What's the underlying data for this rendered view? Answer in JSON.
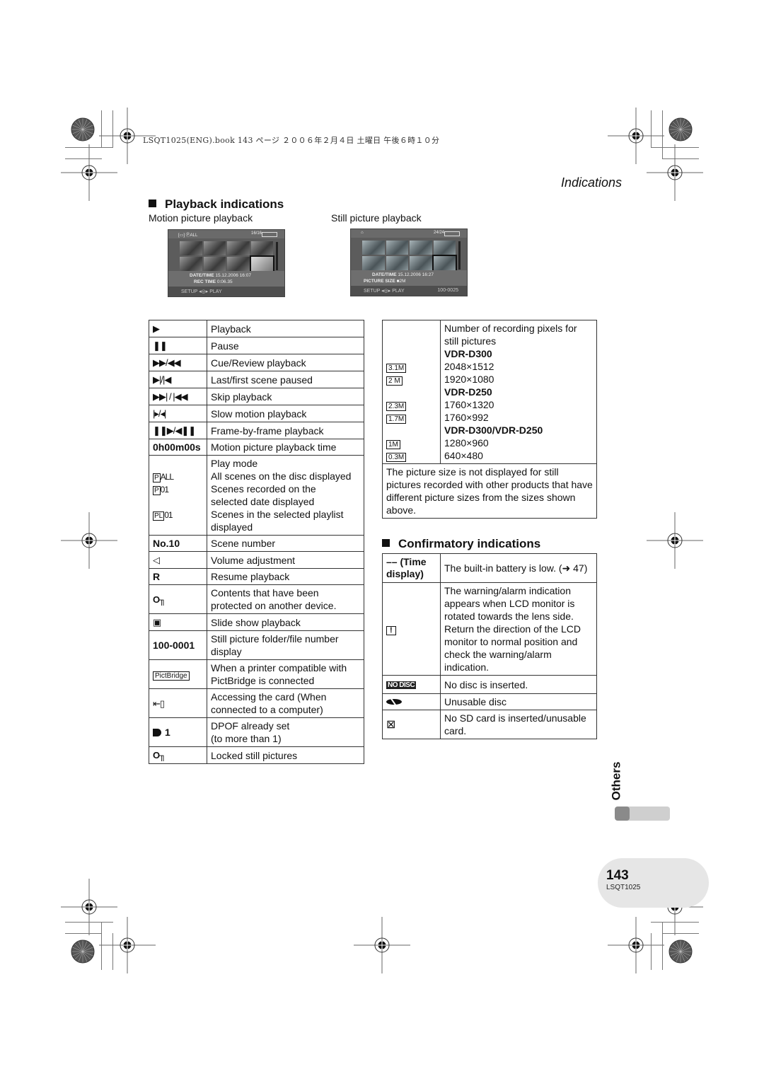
{
  "print_header": "LSQT1025(ENG).book  143 ページ  ２００６年２月４日  土曜日  午後６時１０分",
  "running_head": "Indications",
  "playback_section": {
    "title": "Playback indications",
    "motion_caption": "Motion picture playback",
    "still_caption": "Still picture playback",
    "motion_screen": {
      "top_left": "[▭] ⓅALL",
      "top_right": "16/16",
      "line1_label": "DATE/TIME",
      "line1_value": "15.12.2006  16:07",
      "line2_label": "REC TIME",
      "line2_value": "0:06.35",
      "bottom_left": "SETUP ◂◎▸ PLAY",
      "bottom_right": ""
    },
    "still_screen": {
      "top_left": "⌂",
      "top_right": "24/24",
      "line1_label": "DATE/TIME",
      "line1_value": "15.12.2006  16:27",
      "line2_label": "PICTURE SIZE",
      "line2_value": "■2M",
      "bottom_left": "SETUP ◂◎▸ PLAY",
      "bottom_right": "100-0025"
    }
  },
  "left_table": [
    {
      "symbol": "▶",
      "icon": "play-icon",
      "desc": "Playback"
    },
    {
      "symbol": "❚❚",
      "icon": "pause-icon",
      "desc": "Pause"
    },
    {
      "symbol": "▶▶/◀◀",
      "icon": "cue-review-icon",
      "desc": "Cue/Review playback"
    },
    {
      "symbol": "▶|/|◀",
      "icon": "last-first-scene-icon",
      "desc": "Last/first scene paused"
    },
    {
      "symbol": "▶▶| / |◀◀",
      "icon": "skip-icon",
      "desc": "Skip playback"
    },
    {
      "symbol": "|▸/◂|",
      "icon": "slow-motion-icon",
      "desc": "Slow motion playback"
    },
    {
      "symbol": "❚❚▶/◀❚❚",
      "icon": "frame-by-frame-icon",
      "desc": "Frame-by-frame playback"
    },
    {
      "symbol": "0h00m00s",
      "icon": "",
      "desc": "Motion picture playback time"
    },
    {
      "symbol": "",
      "icon": "play-mode-icon",
      "desc_lines": [
        "Play mode",
        "All scenes on the disc displayed",
        "Scenes recorded on the",
        "selected date displayed",
        "Scenes in the selected playlist",
        "displayed"
      ],
      "sub_symbols": [
        "P ALL",
        "P 01",
        "PL 01"
      ]
    },
    {
      "symbol": "No.10",
      "icon": "",
      "desc": "Scene number"
    },
    {
      "symbol": "◁",
      "icon": "volume-icon",
      "desc": "Volume adjustment"
    },
    {
      "symbol": "R",
      "icon": "",
      "desc": "Resume playback"
    },
    {
      "symbol": "O╖",
      "icon": "key-protect-icon",
      "desc": "Contents that have been protected on another device."
    },
    {
      "symbol": "▣",
      "icon": "slideshow-icon",
      "desc": "Slide show playback"
    },
    {
      "symbol": "100-0001",
      "icon": "",
      "desc": "Still picture folder/file number display"
    },
    {
      "symbol": "PictBridge",
      "icon": "pictbridge-icon",
      "desc": "When a printer compatible with PictBridge is connected"
    },
    {
      "symbol": "⇤▯",
      "icon": "card-access-icon",
      "desc": "Accessing the card (When connected to a computer)"
    },
    {
      "symbol": "1",
      "icon": "dpof-icon",
      "desc_lines": [
        "DPOF already set",
        "(to more than 1)"
      ]
    },
    {
      "symbol": "O╖",
      "icon": "lock-icon",
      "desc": "Locked still pictures"
    }
  ],
  "right_table": {
    "header": [
      "Number of recording pixels for",
      "still pictures"
    ],
    "groups": [
      {
        "model": "VDR-D300",
        "sizes": [
          {
            "badge": "3.1M",
            "pixels": "2048×1512"
          },
          {
            "badge": "2 M",
            "pixels": "1920×1080"
          }
        ]
      },
      {
        "model": "VDR-D250",
        "sizes": [
          {
            "badge": "2.3M",
            "pixels": "1760×1320"
          },
          {
            "badge": "1.7M",
            "pixels": "1760×992"
          }
        ]
      },
      {
        "model": "VDR-D300/VDR-D250",
        "sizes": [
          {
            "badge": "1M",
            "pixels": "1280×960"
          },
          {
            "badge": "0.3M",
            "pixels": "640×480"
          }
        ]
      }
    ],
    "note": "The picture size is not displayed for still pictures recorded with other products that have different picture sizes from the sizes shown above."
  },
  "confirm_section": {
    "title": "Confirmatory indications",
    "rows": [
      {
        "symbol": "–– (Time display)",
        "icon": "",
        "desc": "The built-in battery is low. (➜ 47)"
      },
      {
        "symbol": "!",
        "icon": "warning-alarm-icon",
        "desc": "The warning/alarm indication appears when LCD monitor is rotated towards the lens side. Return the direction of the LCD monitor to normal position and check the warning/alarm indication."
      },
      {
        "symbol": "NO DISC",
        "icon": "no-disc-icon",
        "desc": "No disc is inserted."
      },
      {
        "symbol": "⊘",
        "icon": "unusable-disc-icon",
        "desc": "Unusable disc"
      },
      {
        "symbol": "⊠",
        "icon": "no-sd-card-icon",
        "desc": "No SD card is inserted/unusable card."
      }
    ]
  },
  "side_tab": {
    "label": "Others",
    "progress_fraction": 0.27
  },
  "footer": {
    "page_number": "143",
    "code": "LSQT1025"
  }
}
